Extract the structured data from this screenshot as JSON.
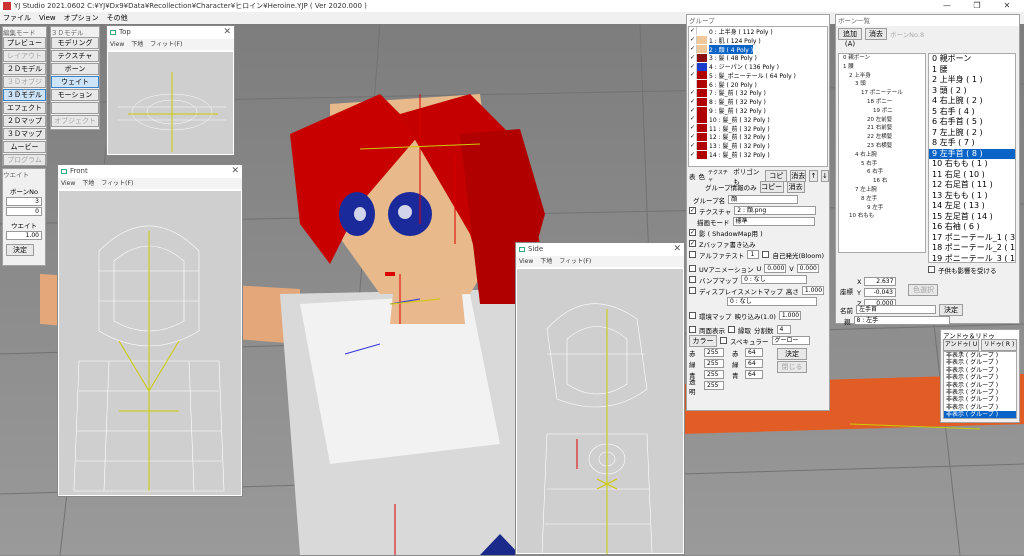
{
  "window": {
    "title": "YJ Studio 2021.0602 C:¥YJ¥Dx9¥Data¥Recollection¥Character¥ヒロイン¥Heroine.YJP ( Ver 2020.000 )",
    "min": "—",
    "max": "❐",
    "close": "✕"
  },
  "menu": [
    "ファイル",
    "View",
    "オプション",
    "その他"
  ],
  "edit_mode": {
    "title": "編集モード",
    "buttons": [
      "プレビュー",
      "レイアウト",
      "２Ｄモデル",
      "３Ｄオブジェクト",
      "３Ｄモデル",
      "エフェクト",
      "２Ｄマップ",
      "３Ｄマップ",
      "ムービー",
      "プログラム"
    ]
  },
  "model3d": {
    "title": "３Ｄモデル",
    "buttons": [
      "モデリング",
      "テクスチャ",
      "ボーン",
      "ウェイト",
      "モーション",
      "",
      "オブジェクト"
    ]
  },
  "weight": {
    "title": "ウエイト",
    "bone_no_label": "ボーンNo",
    "bone_no_a": "3",
    "bone_no_b": "0",
    "weight_label": "ウエイト",
    "weight_value": "1.00",
    "ok": "決定"
  },
  "top_win": {
    "title": "Top",
    "menu": [
      "View",
      "下地",
      "フィット(F)"
    ]
  },
  "front_win": {
    "title": "Front",
    "menu": [
      "View",
      "下地",
      "フィット(F)"
    ]
  },
  "side_win": {
    "title": "Side",
    "menu": [
      "View",
      "下地",
      "フィット(F)"
    ]
  },
  "group": {
    "title": "グループ",
    "items": [
      {
        "label": "0 : 上半身 ( 112 Poly )",
        "checked": true,
        "color": "#ffffff",
        "sel": false
      },
      {
        "label": "1 : 肌 ( 124 Poly )",
        "checked": true,
        "color": "#f0c89a",
        "sel": false
      },
      {
        "label": "2 : 顔 ( 4 Poly )",
        "checked": true,
        "color": "#f0c89a",
        "sel": true
      },
      {
        "label": "3 : 髪 ( 48 Poly )",
        "checked": true,
        "color": "#8a1010",
        "sel": false
      },
      {
        "label": "4 : ジーパン ( 136 Poly )",
        "checked": true,
        "color": "#1a3ccc",
        "sel": false
      },
      {
        "label": "5 : 髪_ポニーテール ( 64 Poly )",
        "checked": true,
        "color": "#b00000",
        "sel": false
      },
      {
        "label": "6 : 髪 ( 20 Poly )",
        "checked": false,
        "color": "#b00000",
        "sel": false
      },
      {
        "label": "7 : 髪_前 ( 32 Poly )",
        "checked": true,
        "color": "#b00000",
        "sel": false
      },
      {
        "label": "8 : 髪_前 ( 32 Poly )",
        "checked": true,
        "color": "#b00000",
        "sel": false
      },
      {
        "label": "9 : 髪_前 ( 32 Poly )",
        "checked": true,
        "color": "#b00000",
        "sel": false
      },
      {
        "label": "10 : 髪_前 ( 32 Poly )",
        "checked": true,
        "color": "#b00000",
        "sel": false
      },
      {
        "label": "11 : 髪_前 ( 32 Poly )",
        "checked": true,
        "color": "#b00000",
        "sel": false
      },
      {
        "label": "12 : 髪_前 ( 32 Poly )",
        "checked": true,
        "color": "#b00000",
        "sel": false
      },
      {
        "label": "13 : 髪_前 ( 32 Poly )",
        "checked": true,
        "color": "#b00000",
        "sel": false
      },
      {
        "label": "14 : 髪_前 ( 32 Poly )",
        "checked": true,
        "color": "#b00000",
        "sel": false
      }
    ],
    "header_tabs": [
      "表",
      "色",
      "テクスチャ"
    ],
    "poly_label": "ポリゴンも",
    "copy": "コピー",
    "erase": "消去",
    "up": "↑",
    "down": "↓",
    "info_label": "グループ情報のみ",
    "name_label": "グループ名",
    "name_value": "顔",
    "texture_label": "テクスチャ",
    "texture_value": "2 : 顔.png",
    "draw_mode_label": "描画モード",
    "draw_mode_value": "標準",
    "shadow_label": "影 ( ShadowMap用 )",
    "zbuffer_label": "Zバッファ書き込み",
    "alpha_label": "アルファテスト",
    "alpha_value": "1",
    "bloom_label": "自己発光(Bloom)",
    "uv_label": "UVアニメーション",
    "u_label": "U",
    "u_value": "0.000",
    "v_label": "V",
    "v_value": "0.000",
    "bump_label": "バンプマップ",
    "bump_value": "0 : なし",
    "disp_label": "ディスプレイスメントマップ",
    "height_label": "高さ",
    "height_value": "1.000",
    "disp_value": "0 : なし",
    "env_label": "環境マップ",
    "env_ratio_label": "映り込み(1.0)",
    "env_ratio_value": "1.000",
    "double_label": "両面表示",
    "edge_label": "縁取",
    "div_label": "分割数",
    "div_value": "4",
    "color_btn": "カラー",
    "spec_label": "スペキュラー",
    "spec_value": "グーロー",
    "rgb_labels": [
      "赤",
      "緑",
      "青",
      "透明"
    ],
    "rgb_values": [
      "255",
      "255",
      "255",
      "255"
    ],
    "spec_labels": [
      "赤",
      "緑",
      "青"
    ],
    "spec_values": [
      "64",
      "64",
      "64"
    ],
    "ok": "決定",
    "close": "閉じる"
  },
  "bone": {
    "title": "ボーン一覧",
    "add": "追加(A)",
    "erase": "消去",
    "bone_no": "ボーンNo.8",
    "tree": [
      "0 親ボーン",
      "1 腰",
      "2 上半身",
      "3 頭",
      "17 ポニーテール",
      "18 ポニー",
      "19 ポニ",
      "20 左前髪",
      "21 右前髪",
      "22 左横髪",
      "23 右横髪",
      "4 右上腕",
      "5 右手",
      "6 右手",
      "16 右",
      "7 左上腕",
      "8 左手",
      "9 左手",
      "10 右もも"
    ],
    "list": [
      "0 親ボーン",
      "1 腰",
      "2 上半身 ( 1 )",
      "3 頭 ( 2 )",
      "4 右上腕 ( 2 )",
      "5 右手 ( 4 )",
      "6 右手首 ( 5 )",
      "7 左上腕 ( 2 )",
      "8 左手 ( 7 )",
      "9 左手首 ( 8 )",
      "10 右もも ( 1 )",
      "11 右足 ( 10 )",
      "12 右足首 ( 11 )",
      "13 左もも ( 1 )",
      "14 左足 ( 13 )",
      "15 左足首 ( 14 )",
      "16 右袖 ( 6 )",
      "17 ポニーテール_1 ( 3 )",
      "18 ポニーテール_2 ( 17 )",
      "19 ポニーテール_3 ( 18 )"
    ],
    "sel_index": 9,
    "child_label": "子供も影響を受ける",
    "coord_label": "座標",
    "x_label": "X",
    "x_value": "2.637",
    "y_label": "Y",
    "y_value": "-0.043",
    "z_label": "Z",
    "z_value": "0.000",
    "color_select": "色選択",
    "name_label": "名前",
    "name_value": "左手首",
    "ok": "決定",
    "parent_label": "親",
    "parent_value": "8 : 左手"
  },
  "anime": {
    "title": "アンドゥ＆リドゥ",
    "undo": "アンドゥ( U )",
    "redo": "リドゥ( R )",
    "items": [
      "非表示 ( グループ )",
      "非表示 ( グループ )",
      "非表示 ( グループ )",
      "非表示 ( グループ )",
      "非表示 ( グループ )",
      "非表示 ( グループ )",
      "非表示 ( グループ )",
      "非表示 ( グループ )",
      "非表示 ( グループ )"
    ],
    "sel_index": 8
  }
}
